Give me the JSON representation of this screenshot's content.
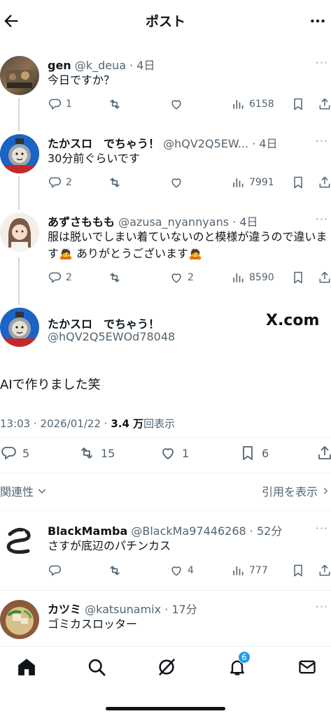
{
  "header": {
    "title": "ポスト"
  },
  "thread": [
    {
      "name": "gen",
      "handle": "@k_deua",
      "time": "· 4日",
      "text": "今日ですか？",
      "replies": "1",
      "retweets": "",
      "likes": "",
      "views": "6158"
    },
    {
      "name": "たかスロ　でちゃう！",
      "handle": "@hQV2Q5EW...",
      "time": "· 4日",
      "text": "30分前ぐらいです",
      "replies": "2",
      "retweets": "",
      "likes": "",
      "views": "7991"
    },
    {
      "name": "あずさももも",
      "handle": "@azusa_nyannyans",
      "time": "· 4日",
      "text": "服は脱いでしまい着ていないのと模様が違うので違います🙇 ありがとうございます🙇",
      "replies": "2",
      "retweets": "",
      "likes": "2",
      "views": "8590"
    }
  ],
  "main_post": {
    "name": "たかスロ　でちゃう！",
    "handle": "@hQV2Q5EWOd78048",
    "watermark": "X.com",
    "text": "AIで作りました笑",
    "datetime": "13:03 · 2026/01/22 ·",
    "views_count": "3.4 万",
    "views_label": "回表示",
    "replies": "5",
    "retweets": "15",
    "likes": "1",
    "bookmarks": "6"
  },
  "filters": {
    "relevance": "関連性",
    "show_quotes": "引用を表示"
  },
  "replies": [
    {
      "name": "BlackMamba",
      "handle": "@BlackMa97446268",
      "time": "· 52分",
      "text": "さすが底辺のパチンカス",
      "replies": "",
      "retweets": "",
      "likes": "4",
      "views": "777"
    },
    {
      "name": "カツミ",
      "handle": "@katsunamix",
      "time": "· 17分",
      "text": "ゴミカスロッター"
    }
  ],
  "nav": {
    "notifications_badge": "6"
  },
  "colors": {
    "accent": "#1d9bf0",
    "text": "#0f1419",
    "muted": "#536471",
    "divider": "#eff3f4"
  }
}
